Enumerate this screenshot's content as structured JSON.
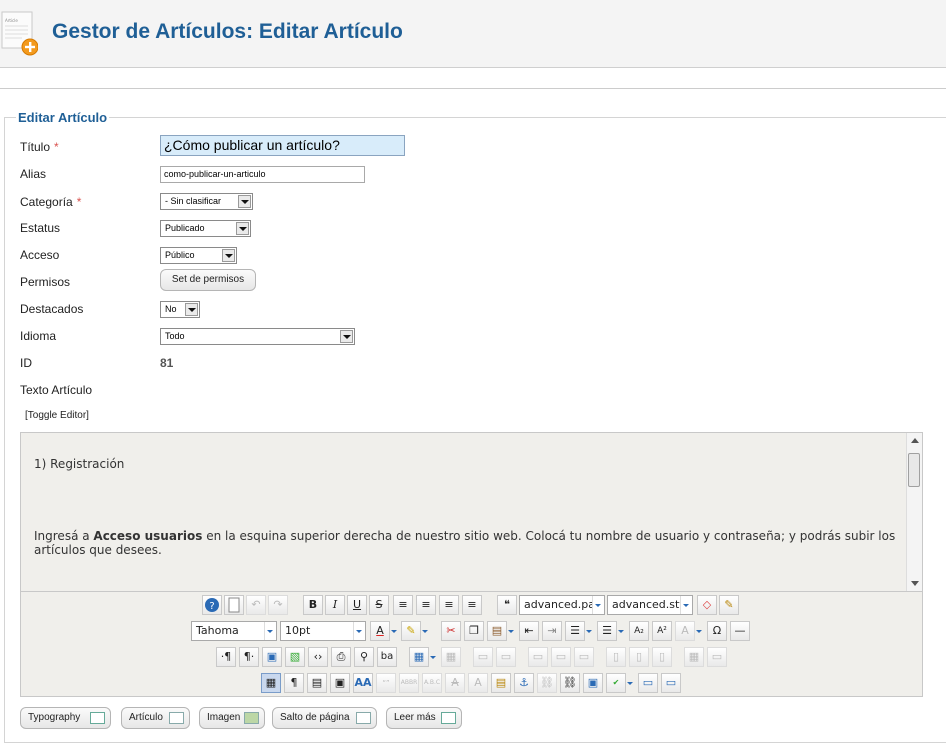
{
  "header": {
    "title": "Gestor de Artículos: Editar Artículo",
    "icon_label": "Article",
    "accent": "#1f5f96"
  },
  "form": {
    "legend": "Editar Artículo",
    "labels": {
      "titulo": "Título",
      "alias": "Alias",
      "categoria": "Categoría",
      "estatus": "Estatus",
      "acceso": "Acceso",
      "permisos": "Permisos",
      "destacados": "Destacados",
      "idioma": "Idioma",
      "id": "ID",
      "texto": "Texto Artículo"
    },
    "required_mark": "*",
    "values": {
      "titulo": "¿Cómo publicar un artículo?",
      "alias": "como-publicar-un-articulo",
      "categoria": "- Sin clasificar",
      "estatus": "Publicado",
      "acceso": "Público",
      "destacados": "No",
      "idioma": "Todo",
      "id": "81"
    },
    "permisos_button": "Set de permisos",
    "toggle_editor": "[Toggle Editor]"
  },
  "editor": {
    "line1": "1) Registración",
    "para_pre": "Ingresá a ",
    "para_bold": "Acceso usuarios",
    "para_post1": " en la esquina superior derecha de nuestro sitio web. Colocá tu nombre de usuario y contraseña; y podrás subir los",
    "para_post2": "artículos que desees."
  },
  "toolbar": {
    "format_select": "advanced.para",
    "style_select": "advanced.style",
    "font_select": "Tahoma",
    "size_select": "10pt",
    "bold": "B",
    "italic": "I",
    "underline": "U",
    "strike": "S",
    "subscript": "A₂",
    "superscript": "A²",
    "omega": "Ω",
    "pilcrow": "¶"
  },
  "buttons": {
    "typography": "Typography",
    "articulo": "Artículo",
    "imagen": "Imagen",
    "salto": "Salto de página",
    "leer_mas": "Leer más"
  }
}
